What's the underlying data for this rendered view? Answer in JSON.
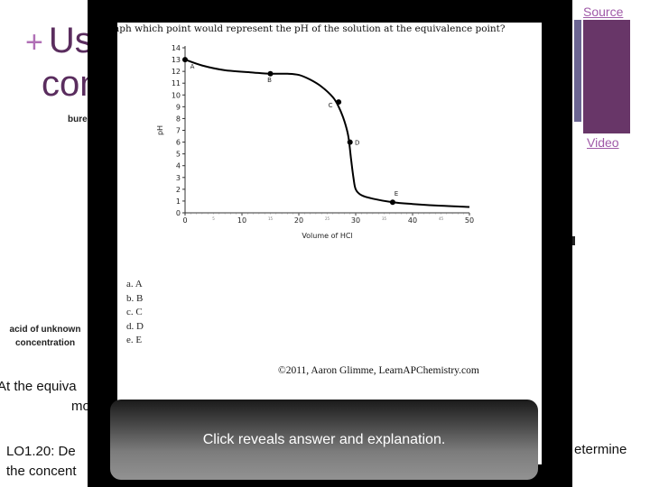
{
  "slide": {
    "title_plus": "+",
    "title_line1": "Usi",
    "title_line2": "con",
    "burette_label": "bure",
    "acid_label_line1": "acid of unknown",
    "acid_label_line2": "concentration",
    "equivalence_line1": "At the equiva",
    "equivalence_line2": "mo",
    "lo_line1": "LO1.20: De",
    "lo_line2": "the concent",
    "lo_right": "etermine",
    "source_link": "Source",
    "video_link": "Video",
    "colors": {
      "title": "#5a2d5e",
      "link": "#a05aa8",
      "blue_bar": "#6b6592",
      "purple_bar": "#683668"
    }
  },
  "question": {
    "text": "aph which point would represent the pH of the solution at the equivalence point?",
    "options": [
      "a. A",
      "b. B",
      "c. C",
      "d. D",
      "e. E"
    ],
    "copyright": "©2011, Aaron Glimme, LearnAPChemistry.com"
  },
  "reveal_button": {
    "label": "Click reveals answer and explanation."
  },
  "chart_data": {
    "type": "line",
    "title": "",
    "xlabel": "Volume of HCl",
    "ylabel": "pH",
    "xlim": [
      0,
      50
    ],
    "ylim": [
      0,
      14
    ],
    "x_ticks": [
      0,
      10,
      20,
      30,
      40,
      50
    ],
    "x_minor_ticks": [
      5,
      15,
      25,
      35,
      45
    ],
    "y_ticks": [
      0,
      1,
      2,
      3,
      4,
      5,
      6,
      7,
      8,
      9,
      10,
      11,
      12,
      13,
      14
    ],
    "grid": false,
    "series": [
      {
        "name": "titration curve",
        "x": [
          0,
          3,
          7,
          12,
          15,
          18,
          20,
          22,
          24,
          26,
          27,
          28,
          28.7,
          29.2,
          29.6,
          30,
          31,
          33,
          36.5,
          40,
          45,
          50
        ],
        "y": [
          13,
          12.5,
          12.1,
          11.9,
          11.8,
          11.8,
          11.7,
          11.3,
          10.7,
          9.8,
          9.0,
          7.8,
          6.5,
          4.5,
          3.0,
          2.0,
          1.5,
          1.2,
          0.9,
          0.75,
          0.6,
          0.5
        ]
      }
    ],
    "points": [
      {
        "label": "A",
        "x": 0,
        "y": 13
      },
      {
        "label": "B",
        "x": 15,
        "y": 11.8
      },
      {
        "label": "C",
        "x": 27,
        "y": 9.4
      },
      {
        "label": "D",
        "x": 29,
        "y": 6.0
      },
      {
        "label": "E",
        "x": 36.5,
        "y": 0.9
      }
    ]
  }
}
